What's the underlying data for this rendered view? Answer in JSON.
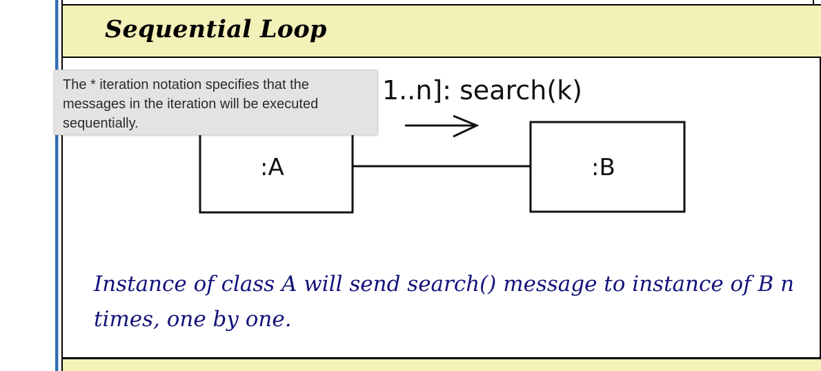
{
  "section": {
    "title": "Sequential Loop"
  },
  "diagram": {
    "message_label": "1..n]: search(k)",
    "object_a_label": ":A",
    "object_b_label": ":B"
  },
  "caption": {
    "text": "Instance of class A will send search() message to instance of B n times, one by one."
  },
  "tooltip": {
    "text": "The * iteration notation specifies that the messages in the iteration will be executed sequentially."
  },
  "colors": {
    "title_band": "#f3f0b8",
    "caption_text": "#12127a",
    "left_rule": "#2f6db3",
    "tooltip_bg": "#e3e3e3"
  }
}
